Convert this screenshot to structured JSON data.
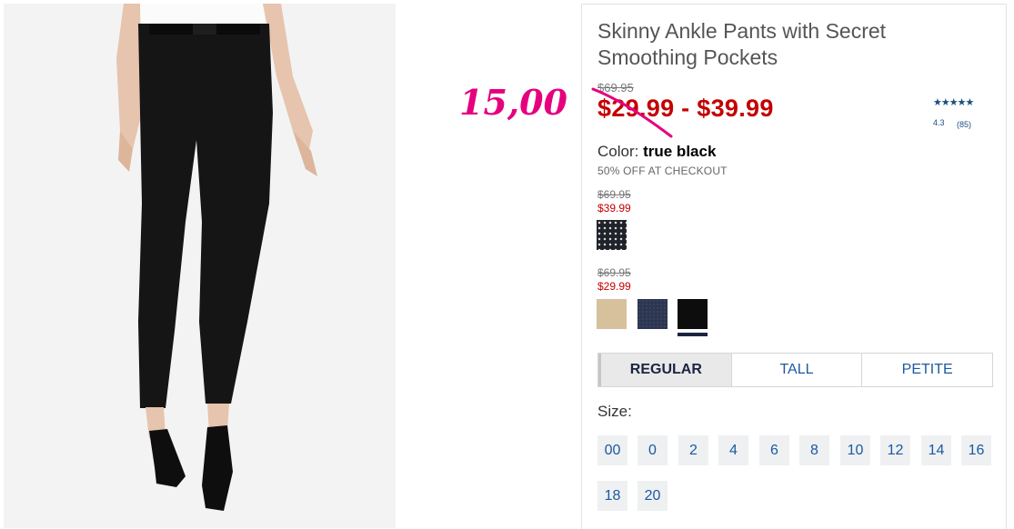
{
  "product": {
    "title": "Skinny Ankle Pants with Secret Smoothing Pockets",
    "original_price": "$69.95",
    "sale_range": "$29.99 - $39.99",
    "handwritten_note": "15,00",
    "rating": {
      "stars": "★★★★★",
      "score": "4.3",
      "count": "(85)"
    },
    "color_label": "Color:",
    "color_value": "true black",
    "promo": "50% OFF AT CHECKOUT"
  },
  "color_groups": [
    {
      "original": "$69.95",
      "sale": "$39.99",
      "swatches": [
        "dotted-print"
      ]
    },
    {
      "original": "$69.95",
      "sale": "$29.99",
      "swatches": [
        "khaki",
        "navy",
        "true-black"
      ]
    }
  ],
  "fits": [
    "REGULAR",
    "TALL",
    "PETITE"
  ],
  "selected_fit": "REGULAR",
  "size_label": "Size:",
  "sizes": [
    "00",
    "0",
    "2",
    "4",
    "6",
    "8",
    "10",
    "12",
    "14",
    "16",
    "18",
    "20"
  ],
  "colors": {
    "sale": "#c40000",
    "link": "#1b5aa0",
    "annotation": "#e6007e"
  }
}
